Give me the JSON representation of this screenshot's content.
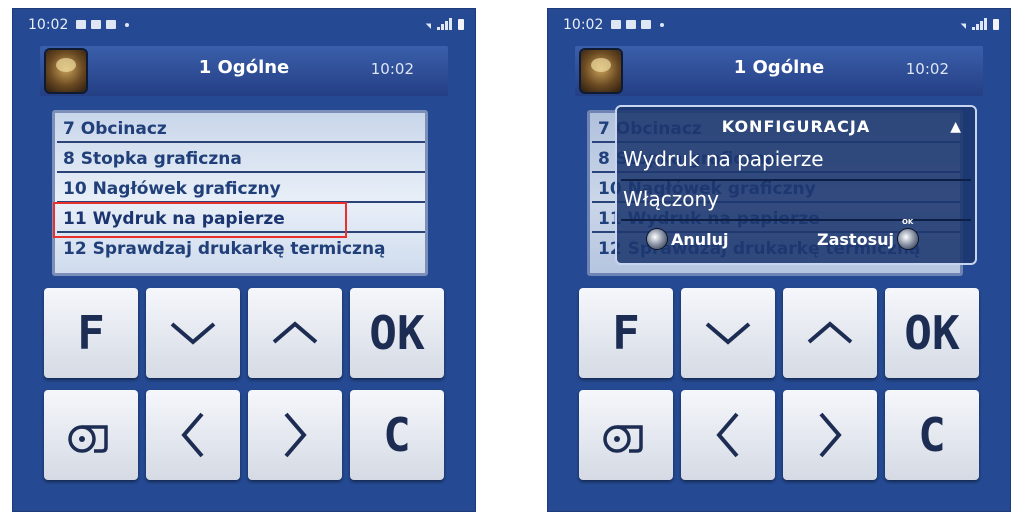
{
  "status": {
    "time": "10:02"
  },
  "title": {
    "text": "1 Ogólne",
    "time": "10:02"
  },
  "menu": {
    "items": [
      {
        "label": "7 Obcinacz"
      },
      {
        "label": "8 Stopka graficzna"
      },
      {
        "label": "10 Nagłówek graficzny"
      },
      {
        "label": "11 Wydruk na papierze"
      },
      {
        "label": "12 Sprawdzaj drukarkę termiczną"
      }
    ],
    "selected_index": 3
  },
  "keys": {
    "f": "F",
    "ok": "OK",
    "c": "C"
  },
  "dialog": {
    "title": "KONFIGURACJA",
    "setting": "Wydruk na papierze",
    "value": "Włączony",
    "cancel": "Anuluj",
    "apply": "Zastosuj",
    "knob_label": "OK"
  },
  "colors": {
    "panel_bg": "#254a93",
    "highlight": "#e8302c",
    "menu_text": "#21407a"
  },
  "icons": [
    "picture-icon",
    "notification-icon",
    "document-icon",
    "wifi-icon",
    "signal-icon",
    "battery-icon",
    "chevron-down-icon",
    "chevron-up-icon",
    "chevron-left-icon",
    "chevron-right-icon",
    "paper-roll-icon",
    "up-arrow-icon"
  ]
}
